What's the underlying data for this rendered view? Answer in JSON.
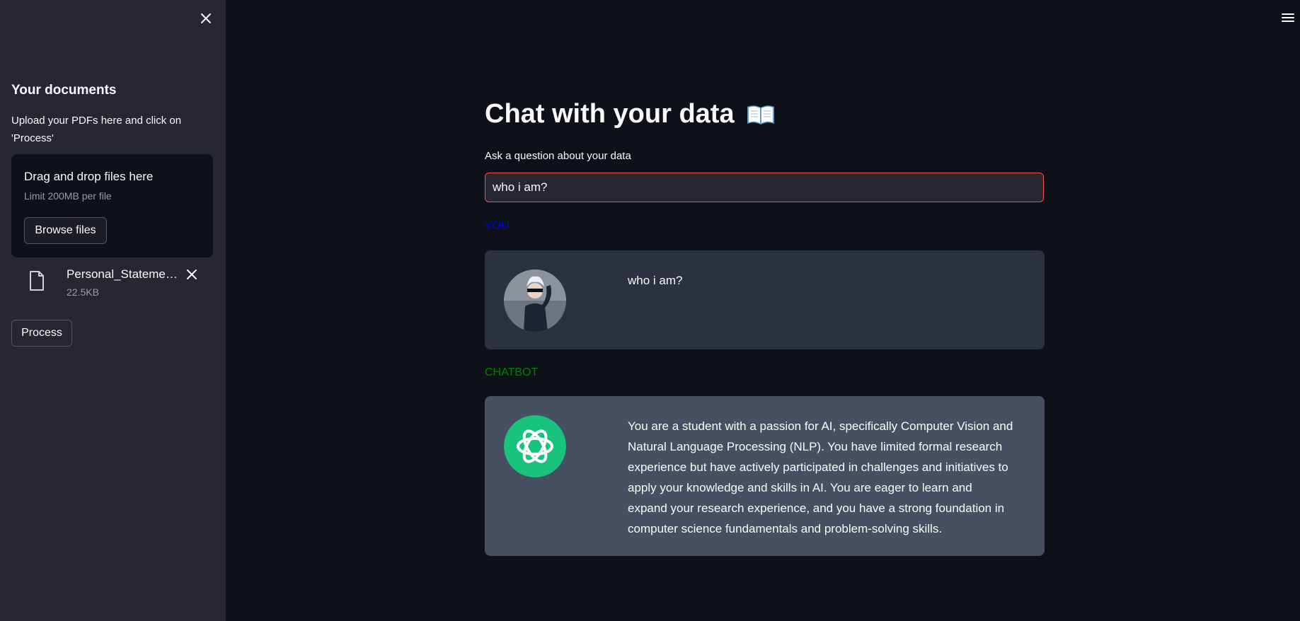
{
  "sidebar": {
    "title": "Your documents",
    "description": "Upload your PDFs here and click on 'Process'",
    "dropzone": {
      "title": "Drag and drop files here",
      "limit": "Limit 200MB per file",
      "browse_label": "Browse files"
    },
    "file": {
      "name": "Personal_Statement.pdf",
      "size": "22.5KB"
    },
    "process_label": "Process"
  },
  "main": {
    "title": "Chat with your data",
    "title_icon": "open-book-icon",
    "question_label": "Ask a question about your data",
    "question_value": "who i am?",
    "user_label": "YOU",
    "bot_label": "CHATBOT",
    "user_message": "who i am?",
    "bot_message": "You are a student with a passion for AI, specifically Computer Vision and Natural Language Processing (NLP). You have limited formal research experience but have actively participated in challenges and initiatives to apply your knowledge and skills in AI. You are eager to learn and expand your research experience, and you have a strong foundation in computer science fundamentals and problem-solving skills."
  },
  "colors": {
    "background": "#0e1117",
    "sidebar": "#262730",
    "user_label": "#0000ff",
    "bot_label": "#008000",
    "input_border": "#ff4b4b",
    "openai_green": "#19c37d"
  }
}
